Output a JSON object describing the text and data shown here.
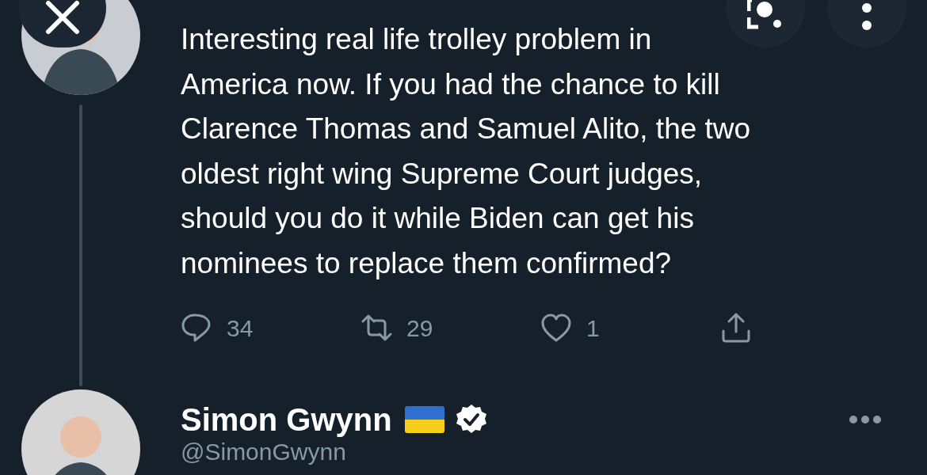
{
  "tweet": {
    "text_lines": [
      "Interesting real life trolley problem in",
      "America now. If you had the chance to kill",
      "Clarence Thomas and Samuel Alito, the two",
      "oldest right wing Supreme Court judges,",
      "should you do it while Biden can get his",
      "nominees to replace them confirmed?"
    ],
    "actions": [
      {
        "kind": "reply",
        "count": "34"
      },
      {
        "kind": "retweet",
        "count": "29"
      },
      {
        "kind": "like",
        "count": "1"
      },
      {
        "kind": "share"
      }
    ]
  },
  "next_tweet": {
    "name": "Simon Gwynn",
    "flag_shown": true,
    "verified": true,
    "handle": "@SimonGwynn"
  }
}
